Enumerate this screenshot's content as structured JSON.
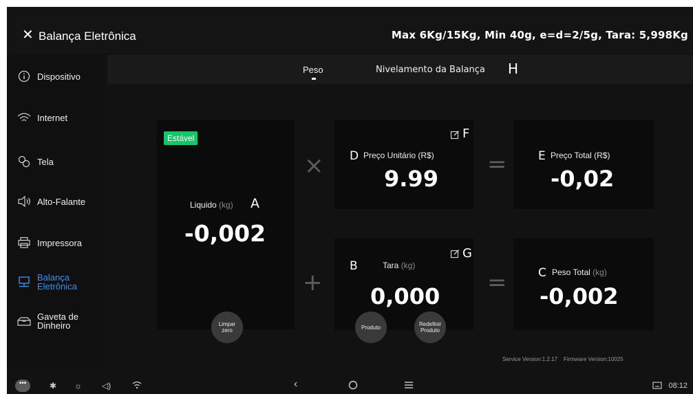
{
  "header": {
    "title": "Balança Eletrônica",
    "specs": "Max 6Kg/15Kg, Min 40g, e=d=2/5g, Tara: 5,998Kg"
  },
  "sidebar": {
    "items": [
      {
        "label": "Dispositivo",
        "icon": "info-icon"
      },
      {
        "label": "Internet",
        "icon": "wifi-icon"
      },
      {
        "label": "Tela",
        "icon": "display-settings-icon"
      },
      {
        "label": "Alto-Falante",
        "icon": "speaker-icon"
      },
      {
        "label": "Impressora",
        "icon": "printer-icon"
      },
      {
        "label": "Balança Eletrônica",
        "line1": "Balança",
        "line2": "Eletrônica",
        "icon": "scale-icon",
        "active": true
      },
      {
        "label": "Gaveta de Dinheiro",
        "line1": "Gaveta de",
        "line2": "Dinheiro",
        "icon": "cash-drawer-icon"
      }
    ]
  },
  "tabs": {
    "peso": "Peso",
    "nivelamento": "Nivelamento da Balança",
    "marker": "H"
  },
  "net_card": {
    "status": "Estável",
    "label": "Liquido",
    "unit": "(kg)",
    "marker": "A",
    "value": "-0,002",
    "button_line1": "Limpar",
    "button_line2": "zero"
  },
  "unit_price_card": {
    "marker": "D",
    "label": "Preço Unitário (R$)",
    "edit_marker": "F",
    "value": "9.99"
  },
  "total_price_card": {
    "marker": "E",
    "label": "Preço Total (R$)",
    "value": "-0,02"
  },
  "tare_card": {
    "marker": "B",
    "label": "Tara",
    "unit": "(kg)",
    "edit_marker": "G",
    "value": "0,000",
    "product_button": "Produto",
    "reset_line1": "Redefinir",
    "reset_line2": "Produto"
  },
  "total_weight_card": {
    "marker": "C",
    "label": "Peso Total",
    "unit": "(kg)",
    "value": "-0,002"
  },
  "operators": {
    "multiply": "×",
    "equals": "=",
    "plus": "+"
  },
  "versions": {
    "service": "Service Version:1.2.17",
    "firmware": "Firmware Version:10025"
  },
  "navbar": {
    "time": "08:12"
  },
  "colors": {
    "accent": "#3d8ef2",
    "stable": "#16c46a",
    "background": "#121212"
  }
}
